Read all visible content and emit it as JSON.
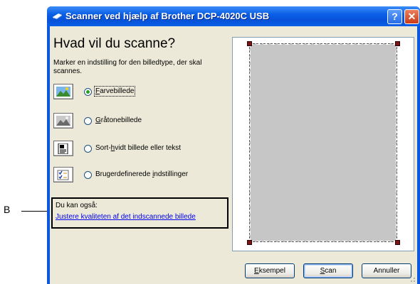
{
  "callout": {
    "letter": "B"
  },
  "window": {
    "title": "Scanner ved hjælp af Brother DCP-4020C USB",
    "help_label": "?",
    "close_label": "✕"
  },
  "main": {
    "heading": "Hvad vil du scanne?",
    "instruction": "Marker en indstilling for den billedtype, der skal scannes.",
    "options": [
      {
        "label_pre": "",
        "label_key": "F",
        "label_post": "arvebillede",
        "selected": true,
        "icon": "color-picture-icon"
      },
      {
        "label_pre": "",
        "label_key": "G",
        "label_post": "råtonebillede",
        "selected": false,
        "icon": "grayscale-picture-icon"
      },
      {
        "label_pre": "Sort-",
        "label_key": "h",
        "label_post": "vidt billede eller tekst",
        "selected": false,
        "icon": "black-white-text-icon"
      },
      {
        "label_pre": "Brugerdefinerede ",
        "label_key": "i",
        "label_post": "ndstillinger",
        "selected": false,
        "icon": "custom-settings-icon"
      }
    ],
    "also": {
      "label": "Du kan også:",
      "link": "Justere kvaliteten af det indscannede billede"
    }
  },
  "buttons": {
    "preview_key": "E",
    "preview_rest": "ksempel",
    "scan_key": "S",
    "scan_rest": "can",
    "cancel": "Annuller"
  },
  "colors": {
    "titlebar": "#0a5fe6",
    "dialog_bg": "#ece9d8",
    "preview_area": "#c6c6c6",
    "crop_handle": "#7a1414",
    "selected_radio": "#21a121",
    "link": "#0000ee"
  }
}
